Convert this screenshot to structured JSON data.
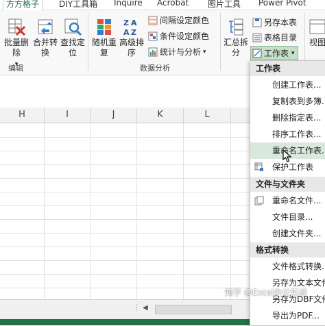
{
  "tabs": [
    {
      "label": "方方格子",
      "active": true
    },
    {
      "label": "DIY工具箱",
      "active": false
    },
    {
      "label": "Inquire",
      "active": false
    },
    {
      "label": "Acrobat",
      "active": false
    },
    {
      "label": "图片工具",
      "active": false
    },
    {
      "label": "Power Pivot",
      "active": false
    }
  ],
  "ribbon": {
    "btn_batch_delete": "批量删除",
    "btn_batch_delete_arrow": "▾",
    "btn_merge_convert_1": "合并转",
    "btn_merge_convert_2": "换",
    "btn_find_locate_1": "查找定",
    "btn_find_locate_2": "位",
    "group_edit": "编辑",
    "btn_random_repeat_1": "随机重",
    "btn_random_repeat_2": "复",
    "btn_advanced_sort_1": "高级排",
    "btn_advanced_sort_2": "序",
    "btn_interval_color": "间隔设定颜色",
    "btn_condition_color": "条件设定颜色",
    "btn_stats_analysis": "统计与分析",
    "group_data_analysis": "数据分析",
    "btn_summary_split_1": "汇总拆",
    "btn_summary_split_2": "分",
    "btn_save_sheet": "另存本表",
    "btn_sheet_directory": "表格目录",
    "btn_worksheet": "工作表",
    "btn_view_partial": "视图",
    "accent_color": "#217346"
  },
  "columns": [
    "H",
    "I",
    "J",
    "K",
    "L"
  ],
  "menu": {
    "sections": [
      {
        "header": "工作表",
        "items": [
          "创建工作表...",
          "复制表到多簿...",
          "删除指定表...",
          "排序工作表...",
          "重命名工作表...",
          "保护工作表"
        ]
      },
      {
        "header": "文件与文件夹",
        "items": [
          "重命名文件...",
          "文件目录...",
          "创建文件夹..."
        ]
      },
      {
        "header": "格式转换",
        "items": [
          "文件格式转换...",
          "另存为文本文件...",
          "另存为DBF文件...",
          "导出为PDF..."
        ]
      }
    ],
    "hover_color": "#d9e8dc"
  },
  "watermark": "知乎 @Excel办公实战",
  "watermark_logo": "知乎"
}
